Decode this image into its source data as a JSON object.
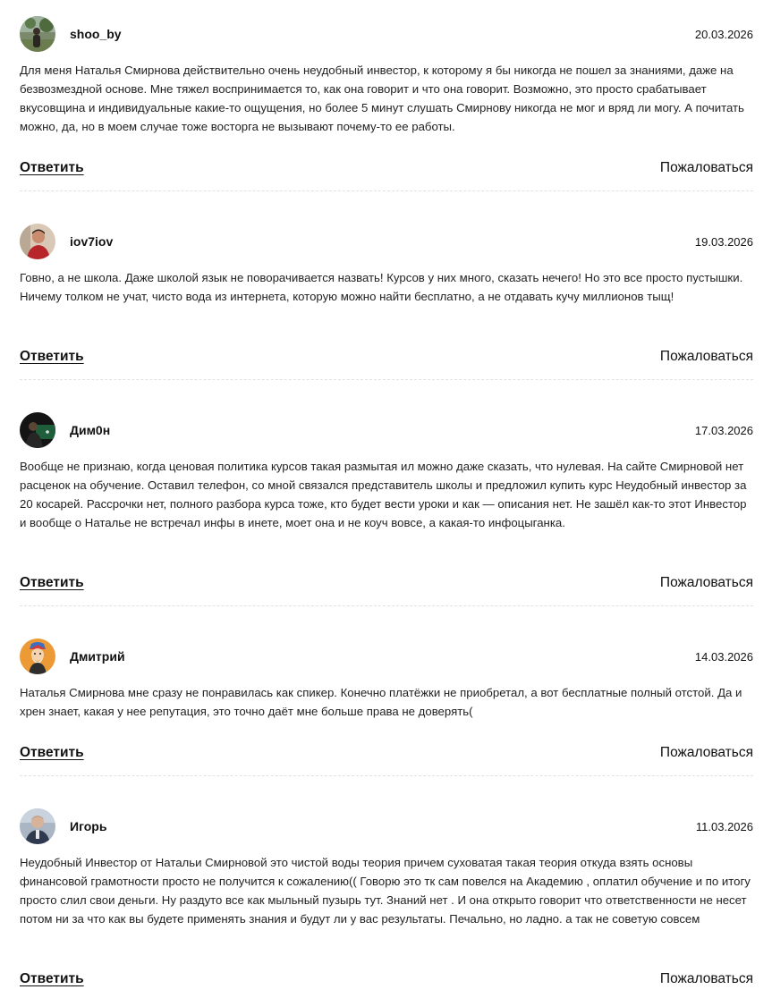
{
  "comments": [
    {
      "author": "shoo_by",
      "date": "20.03.2026",
      "avatar": "avatar-photo-person-outdoors",
      "text": "Для меня Наталья Смирнова действительно очень неудобный инвестор, к которому я бы никогда не пошел за знаниями, даже на безвозмездной основе. Мне тяжел воспринимается то, как она говорит и что она говорит. Возможно, это просто срабатывает вкусовщина и индивидуальные какие-то ощущения, но более 5 минут слушать Смирнову никогда не мог и вряд ли могу. А почитать можно, да, но в моем случае тоже восторга не вызывают почему-то ее работы.",
      "reply_label": "Ответить",
      "complain_label": "Пожаловаться"
    },
    {
      "author": "iov7iov",
      "date": "19.03.2026",
      "avatar": "avatar-photo-man-red-shirt",
      "text": "Говно, а не школа. Даже школой язык не поворачивается назвать! Курсов у них много, сказать нечего! Но это все просто пустышки. Ничему толком не учат, чисто вода из интернета, которую можно найти бесплатно, а не отдавать кучу миллионов тыщ!",
      "reply_label": "Ответить",
      "complain_label": "Пожаловаться"
    },
    {
      "author": "Дим0н",
      "date": "17.03.2026",
      "avatar": "avatar-photo-dark-billiards",
      "text": "Вообще не признаю, когда ценовая политика курсов такая размытая ил можно даже сказать, что нулевая. На сайте Смирновой нет расценок на обучение. Оставил телефон, со мной связался представитель школы и предложил купить курс Неудобный инвестор за 20 косарей. Рассрочки нет, полного разбора курса тоже, кто будет вести уроки и как — описания нет. Не зашёл как-то этот Инвестор и вообще о Наталье не встречал инфы в инете, моет она и не коуч вовсе, а какая-то инфоцыганка.",
      "reply_label": "Ответить",
      "complain_label": "Пожаловаться"
    },
    {
      "author": "Дмитрий",
      "date": "14.03.2026",
      "avatar": "avatar-illustration-orange",
      "text": "Наталья Смирнова мне сразу не понравилась как спикер. Конечно платёжки не приобретал, а вот бесплатные полный отстой. Да и хрен знает, какая у нее репутация, это точно даёт мне больше права не доверять(",
      "reply_label": "Ответить",
      "complain_label": "Пожаловаться"
    },
    {
      "author": "Игорь",
      "date": "11.03.2026",
      "avatar": "avatar-photo-man-bald",
      "text": "Неудобный Инвестор от Натальи Смирновой это чистой воды теория причем суховатая такая теория откуда взять основы финансовой грамотности просто не получится к сожалению(( Говорю это тк сам повелся на Академию , оплатил обучение и по итогу просто слил свои деньги. Ну раздуто все как мыльный пузырь тут. Знаний нет . И она открыто говорит что ответственности не несет потом ни за что как вы будете применять знания и будут ли у вас результаты. Печально, но ладно. а так не советую совсем",
      "reply_label": "Ответить",
      "complain_label": "Пожаловаться"
    }
  ]
}
